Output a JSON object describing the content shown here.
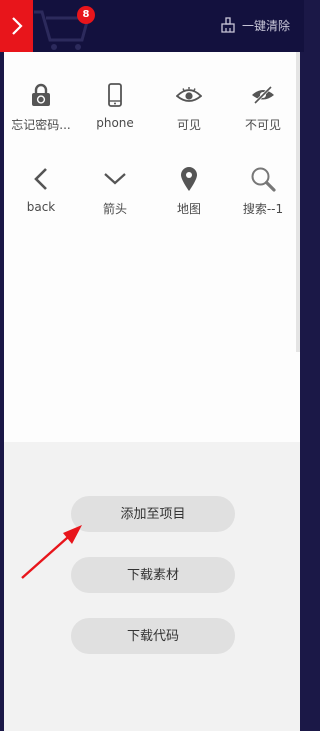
{
  "colors": {
    "accent": "#e8151b",
    "topbar": "#13113e",
    "background": "#1b1847"
  },
  "header": {
    "cart_badge": "8",
    "clear_label": "一键清除"
  },
  "icons": [
    {
      "label": "忘记密码...",
      "icon": "lock-refresh-icon"
    },
    {
      "label": "phone",
      "icon": "phone-icon"
    },
    {
      "label": "可见",
      "icon": "eye-icon"
    },
    {
      "label": "不可见",
      "icon": "eye-slash-icon"
    },
    {
      "label": "back",
      "icon": "chevron-left-icon"
    },
    {
      "label": "箭头",
      "icon": "chevron-down-icon"
    },
    {
      "label": "地图",
      "icon": "map-pin-icon"
    },
    {
      "label": "搜索--1",
      "icon": "search-icon"
    }
  ],
  "actions": {
    "add_to_project": "添加至项目",
    "download_assets": "下载素材",
    "download_code": "下载代码"
  }
}
